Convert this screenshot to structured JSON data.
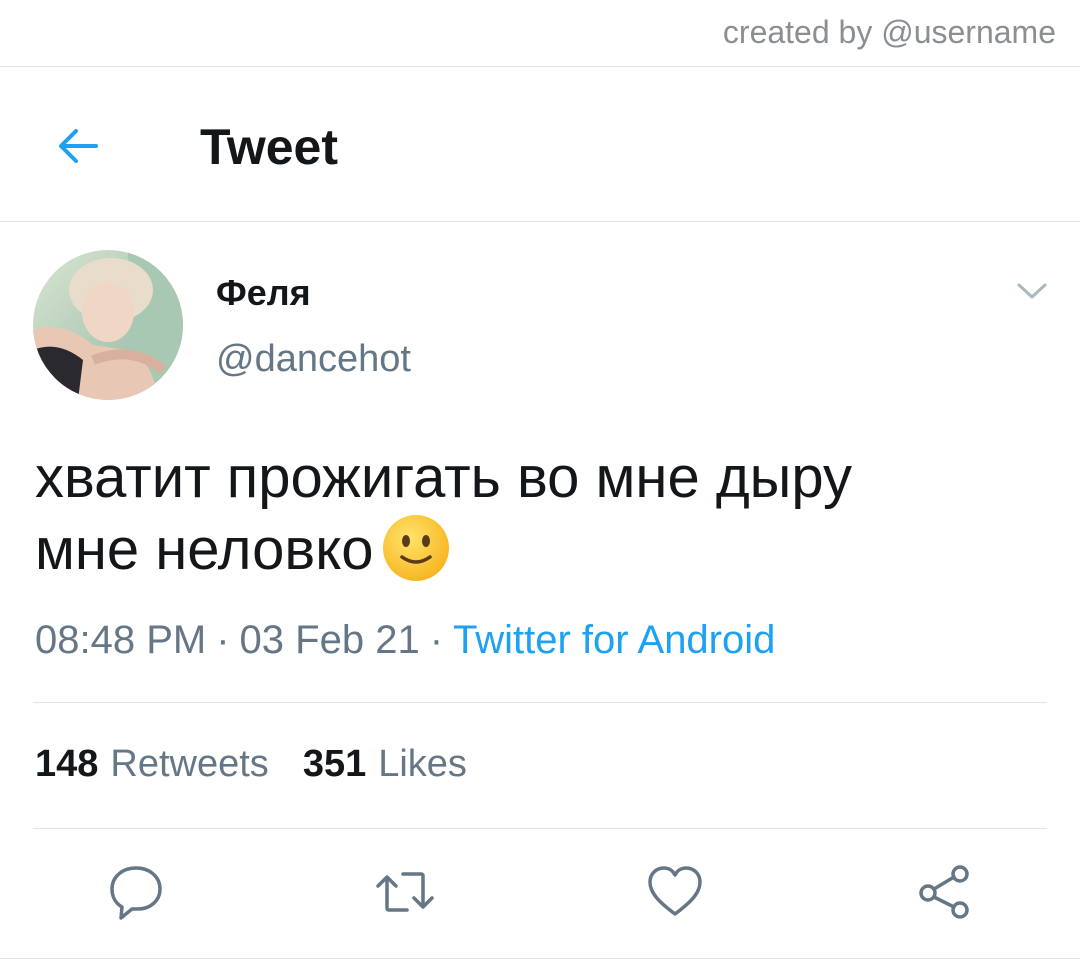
{
  "watermark": "created by @username",
  "header": {
    "title": "Tweet",
    "back_icon": "arrow-left-icon"
  },
  "author": {
    "display_name": "Феля",
    "handle": "@dancehot",
    "menu_icon": "chevron-down-icon"
  },
  "tweet": {
    "text_line1": "хватит прожигать во мне дыру",
    "text_line2": "мне неловко",
    "emoji": "slightly-smiling-face-emoji",
    "time": "08:48 PM",
    "separator": "·",
    "date": "03 Feb 21",
    "source": "Twitter for Android"
  },
  "stats": {
    "retweets_count": "148",
    "retweets_label": "Retweets",
    "likes_count": "351",
    "likes_label": "Likes"
  },
  "actions": [
    {
      "name": "reply",
      "icon": "reply-icon"
    },
    {
      "name": "retweet",
      "icon": "retweet-icon"
    },
    {
      "name": "like",
      "icon": "heart-icon"
    },
    {
      "name": "share",
      "icon": "share-icon"
    }
  ],
  "colors": {
    "accent": "#1da1f2",
    "text_primary": "#14171a",
    "text_secondary": "#657786",
    "divider": "#e1e4e6"
  }
}
